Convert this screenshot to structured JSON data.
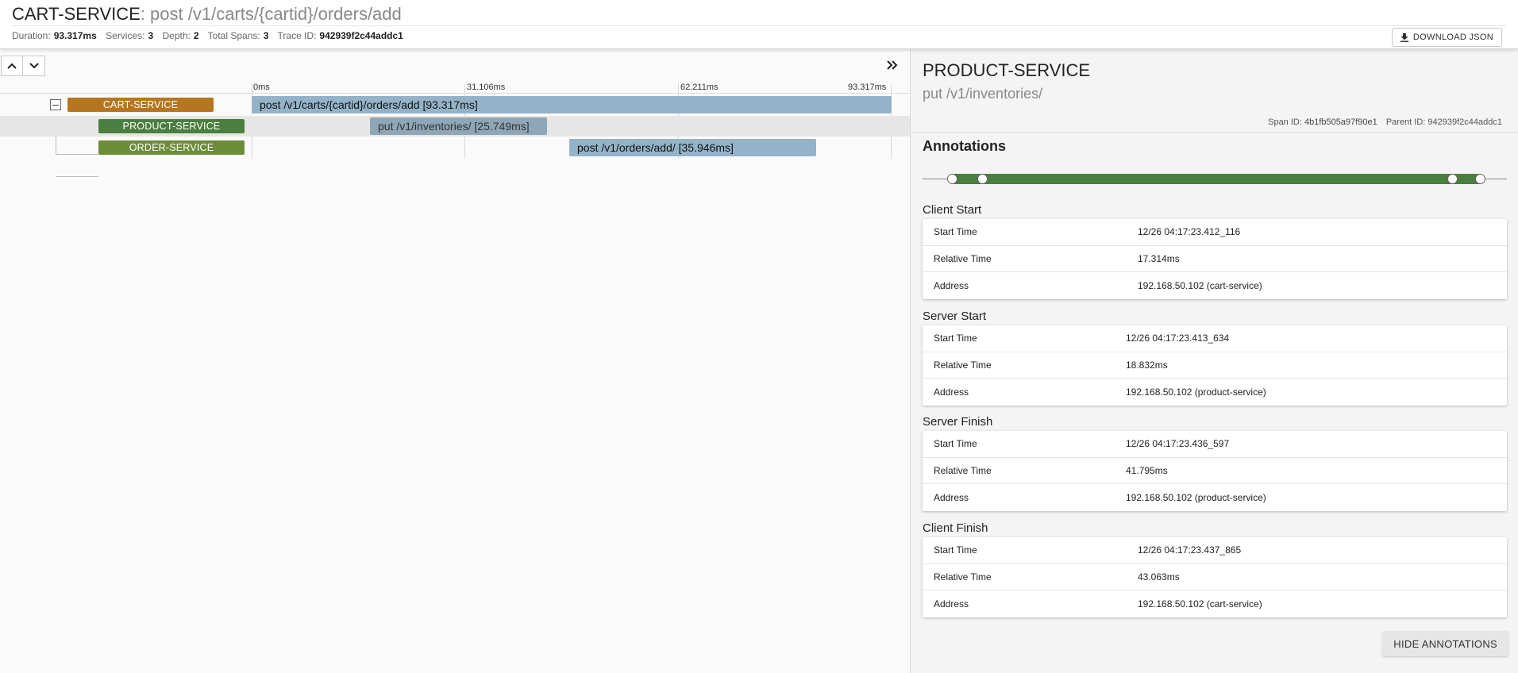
{
  "header": {
    "service": "CART-SERVICE",
    "separator": ":",
    "span_name": " post /v1/carts/{cartid}/orders/add",
    "stats": [
      {
        "label": "Duration:",
        "value": "93.317ms"
      },
      {
        "label": "Services:",
        "value": "3"
      },
      {
        "label": "Depth:",
        "value": "2"
      },
      {
        "label": "Total Spans:",
        "value": "3"
      },
      {
        "label": "Trace ID:",
        "value": "942939f2c44addc1"
      }
    ],
    "download_label": "DOWNLOAD JSON"
  },
  "timeline": {
    "ticks": [
      "0ms",
      "31.106ms",
      "62.211ms",
      "93.317ms"
    ],
    "spans": [
      {
        "service": "CART-SERVICE",
        "label": "post /v1/carts/{cartid}/orders/add [93.317ms]",
        "color": "#b5761f"
      },
      {
        "service": "PRODUCT-SERVICE",
        "label": "put /v1/inventories/ [25.749ms]",
        "color": "#4a7f3f",
        "selected": true
      },
      {
        "service": "ORDER-SERVICE",
        "label": "post /v1/orders/add/ [35.946ms]",
        "color": "#6d8c3a"
      }
    ],
    "span_color": "#94b3c8",
    "span_selected_color": "#8ea6b8"
  },
  "detail": {
    "service": "PRODUCT-SERVICE",
    "span_name": "put /v1/inventories/",
    "span_id_label": "Span ID:",
    "span_id": "4b1fb505a97f90e1",
    "parent_id_label": "Parent ID:",
    "parent_id": "942939f2c44addc1",
    "annotations_title": "Annotations",
    "annotations": [
      {
        "title": "Client Start",
        "rows": [
          {
            "key": "Start Time",
            "value": "12/26 04:17:23.412_116"
          },
          {
            "key": "Relative Time",
            "value": "17.314ms"
          },
          {
            "key": "Address",
            "value": "192.168.50.102 (cart-service)"
          }
        ]
      },
      {
        "title": "Server Start",
        "rows": [
          {
            "key": "Start Time",
            "value": "12/26 04:17:23.413_634"
          },
          {
            "key": "Relative Time",
            "value": "18.832ms"
          },
          {
            "key": "Address",
            "value": "192.168.50.102 (product-service)"
          }
        ]
      },
      {
        "title": "Server Finish",
        "rows": [
          {
            "key": "Start Time",
            "value": "12/26 04:17:23.436_597"
          },
          {
            "key": "Relative Time",
            "value": "41.795ms"
          },
          {
            "key": "Address",
            "value": "192.168.50.102 (product-service)"
          }
        ]
      },
      {
        "title": "Client Finish",
        "rows": [
          {
            "key": "Start Time",
            "value": "12/26 04:17:23.437_865"
          },
          {
            "key": "Relative Time",
            "value": "43.063ms"
          },
          {
            "key": "Address",
            "value": "192.168.50.102 (cart-service)"
          }
        ]
      }
    ],
    "annotation_bar_color": "#4a7f3f",
    "hide_label": "HIDE ANNOTATIONS"
  }
}
